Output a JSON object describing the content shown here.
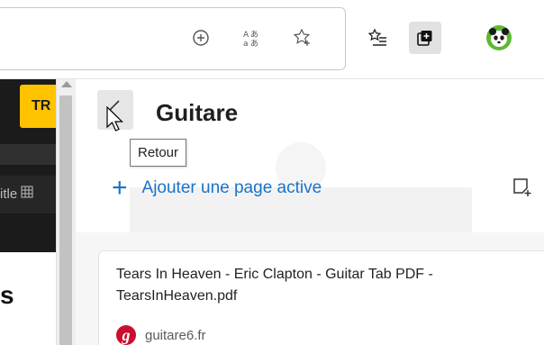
{
  "toolbar": {
    "icons": [
      "add-to-favorites-circle-icon",
      "translate-icon",
      "favorite-star-icon",
      "favorites-list-icon",
      "collections-icon",
      "profile-avatar-icon"
    ]
  },
  "page": {
    "tr_button_label": "TR",
    "title_field_text": "itle",
    "heading_fragment": "s"
  },
  "collections": {
    "title": "Guitare",
    "back_tooltip": "Retour",
    "add_page_label": "Ajouter une page active",
    "items": [
      {
        "title": "Tears In Heaven - Eric Clapton - Guitar Tab PDF - TearsInHeaven.pdf",
        "site": "guitare6.fr",
        "favicon_letter": "g"
      }
    ]
  },
  "colors": {
    "accent": "#1a73c9",
    "brand_yellow": "#ffc300",
    "favicon_red": "#c8102e"
  }
}
